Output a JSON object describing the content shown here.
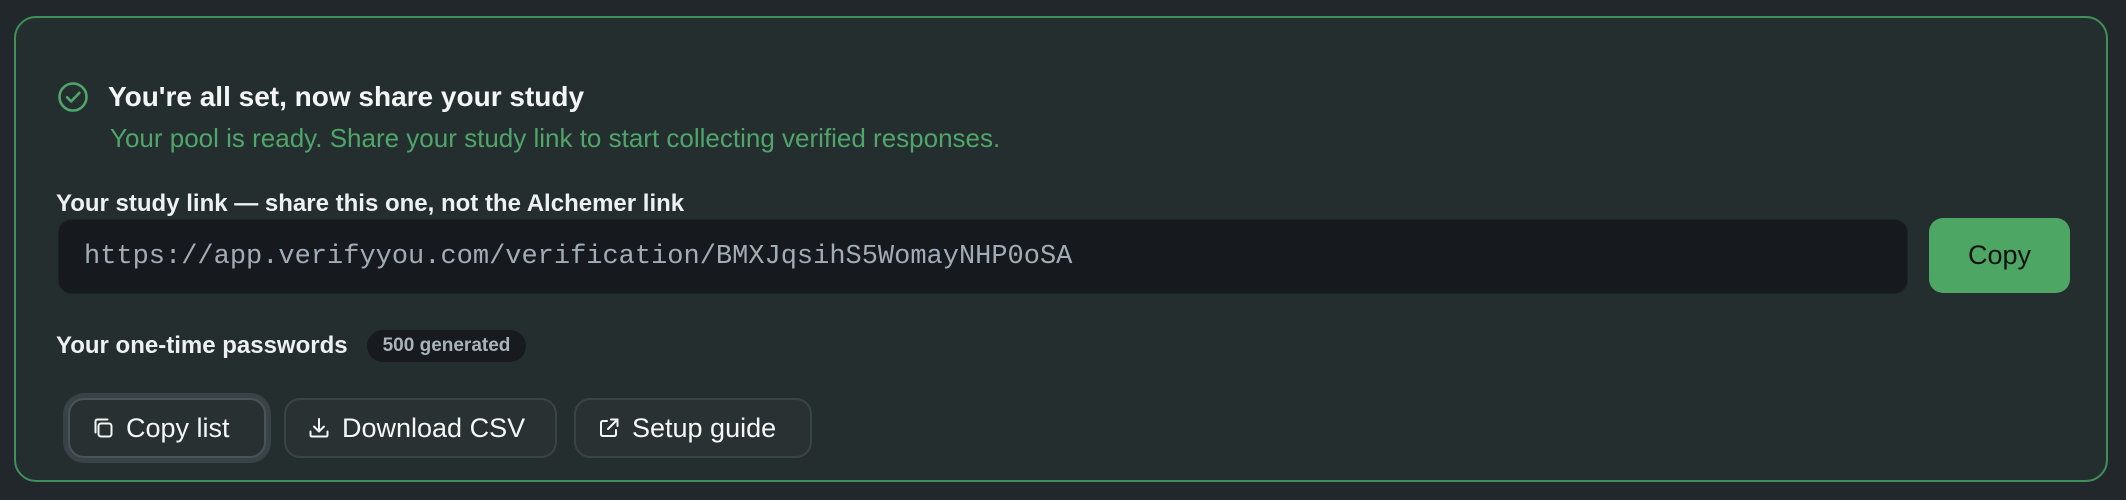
{
  "header": {
    "title": "You're all set, now share your study",
    "subtitle": "Your pool is ready. Share your study link to start collecting verified responses."
  },
  "study_link": {
    "label": "Your study link — share this one, not the Alchemer link",
    "value": "https://app.verifyyou.com/verification/BMXJqsihS5WomayNHP0oSA",
    "copy_label": "Copy"
  },
  "passwords": {
    "label": "Your one-time passwords",
    "badge": "500 generated"
  },
  "actions": {
    "copy_list": "Copy list",
    "download_csv": "Download CSV",
    "setup_guide": "Setup guide"
  },
  "colors": {
    "accent_green": "#4ea665",
    "subtitle_green": "#4fa56a",
    "card_border": "#3f8f5a",
    "card_bg": "#252e2f",
    "page_bg": "#22272b"
  },
  "icons": {
    "header": "check-circle-icon",
    "copy_list": "copy-icon",
    "download_csv": "download-icon",
    "setup_guide": "external-link-icon"
  }
}
